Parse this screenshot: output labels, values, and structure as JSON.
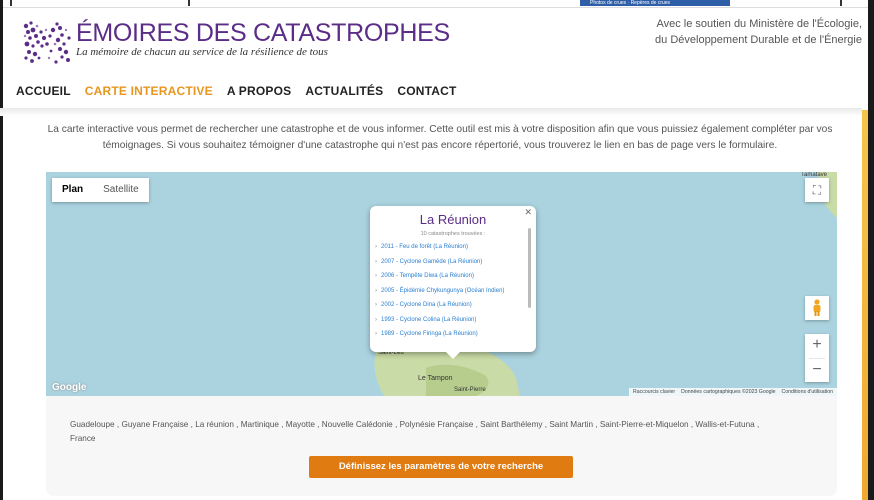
{
  "topstrip": {
    "snippet": "Photos de crues · Repères de crues"
  },
  "header": {
    "logo_title": "ÉMOIRES DES CATASTROPHES",
    "logo_tagline": "La mémoire de chacun au service de la résilience de tous",
    "support_line1": "Avec le soutien du Ministère de l'Écologie,",
    "support_line2": "du Développement Durable et de l'Énergie"
  },
  "nav": {
    "items": [
      {
        "label": "ACCUEIL"
      },
      {
        "label": "CARTE INTERACTIVE"
      },
      {
        "label": "A PROPOS"
      },
      {
        "label": "ACTUALITÉS"
      },
      {
        "label": "CONTACT"
      }
    ],
    "active": "CARTE INTERACTIVE"
  },
  "intro": "La carte interactive vous permet de rechercher une catastrophe et de vous informer. Cette outil est mis à votre disposition afin que vous puissiez également compléter par vos témoignages. Si vous souhaitez témoigner d'une catastrophe qui n'est pas encore répertorié, vous trouverez le lien en bas de page vers le formulaire.",
  "map": {
    "type_plan": "Plan",
    "type_satellite": "Satellite",
    "fullscreen_icon": "fullscreen-icon",
    "zoom_in": "+",
    "zoom_out": "−",
    "google": "Google",
    "labels": {
      "tampon": "Le Tampon",
      "saint": "Saint-Leu",
      "sp": "Saint-Pierre",
      "topright": "Tamatave"
    },
    "attribution": {
      "shortcuts": "Raccourcis clavier",
      "data": "Données cartographiques ©2023 Google",
      "terms": "Conditions d'utilisation"
    },
    "popup": {
      "title": "La Réunion",
      "count": "10 catastrophes trouvées :",
      "items": [
        "2011 - Feu de forêt (La Réunion)",
        "2007 - Cyclone Gamède (La Réunion)",
        "2006 - Tempête Diwa (La Réunion)",
        "2005 - Épidémie Chykungunya (Océan Indien)",
        "2002 - Cyclone Dina (La Réunion)",
        "1993 - Cyclone Colina (La Réunion)",
        "1989 - Cyclone Firinga (La Réunion)"
      ]
    }
  },
  "search": {
    "territories": [
      "Guadeloupe",
      "Guyane Française",
      "La réunion",
      "Martinique",
      "Mayotte",
      "Nouvelle Calédonie",
      "Polynésie Française",
      "Saint Barthélemy",
      "Saint Martin",
      "Saint-Pierre-et-Miquelon",
      "Wallis-et-Futuna",
      "France"
    ],
    "cta": "Définissez les paramètres de votre recherche"
  },
  "colors": {
    "brand_purple": "#5b2d86",
    "accent_orange": "#e8961e",
    "cta_orange": "#e07b12",
    "sea": "#aad3df",
    "land": "#c9dba6"
  }
}
